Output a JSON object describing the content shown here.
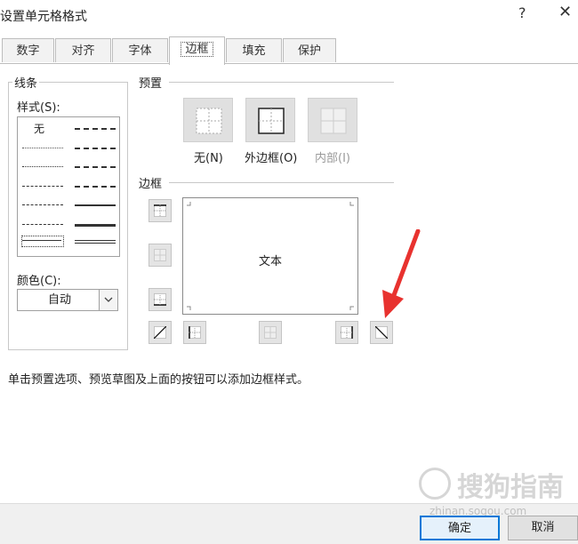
{
  "dialog": {
    "title": "设置单元格格式",
    "help": "?",
    "close": "✕"
  },
  "tabs": [
    {
      "label": "数字",
      "active": false
    },
    {
      "label": "对齐",
      "active": false
    },
    {
      "label": "字体",
      "active": false
    },
    {
      "label": "边框",
      "active": true
    },
    {
      "label": "填充",
      "active": false
    },
    {
      "label": "保护",
      "active": false
    }
  ],
  "line_group": {
    "label": "线条",
    "style_label": "样式(S):",
    "none_option": "无",
    "color_label": "颜色(C):",
    "color_value": "自动"
  },
  "presets": {
    "label": "预置",
    "none": "无(N)",
    "outline": "外边框(O)",
    "inside": "内部(I)"
  },
  "border": {
    "label": "边框",
    "preview_text": "文本"
  },
  "hint": "单击预置选项、预览草图及上面的按钮可以添加边框样式。",
  "buttons": {
    "ok": "确定",
    "cancel": "取消"
  },
  "watermark": {
    "text": "搜狗指南",
    "url": "zhinan.sogou.com"
  },
  "colors": {
    "accent": "#0078d7",
    "annotation_arrow": "#e8322f"
  }
}
